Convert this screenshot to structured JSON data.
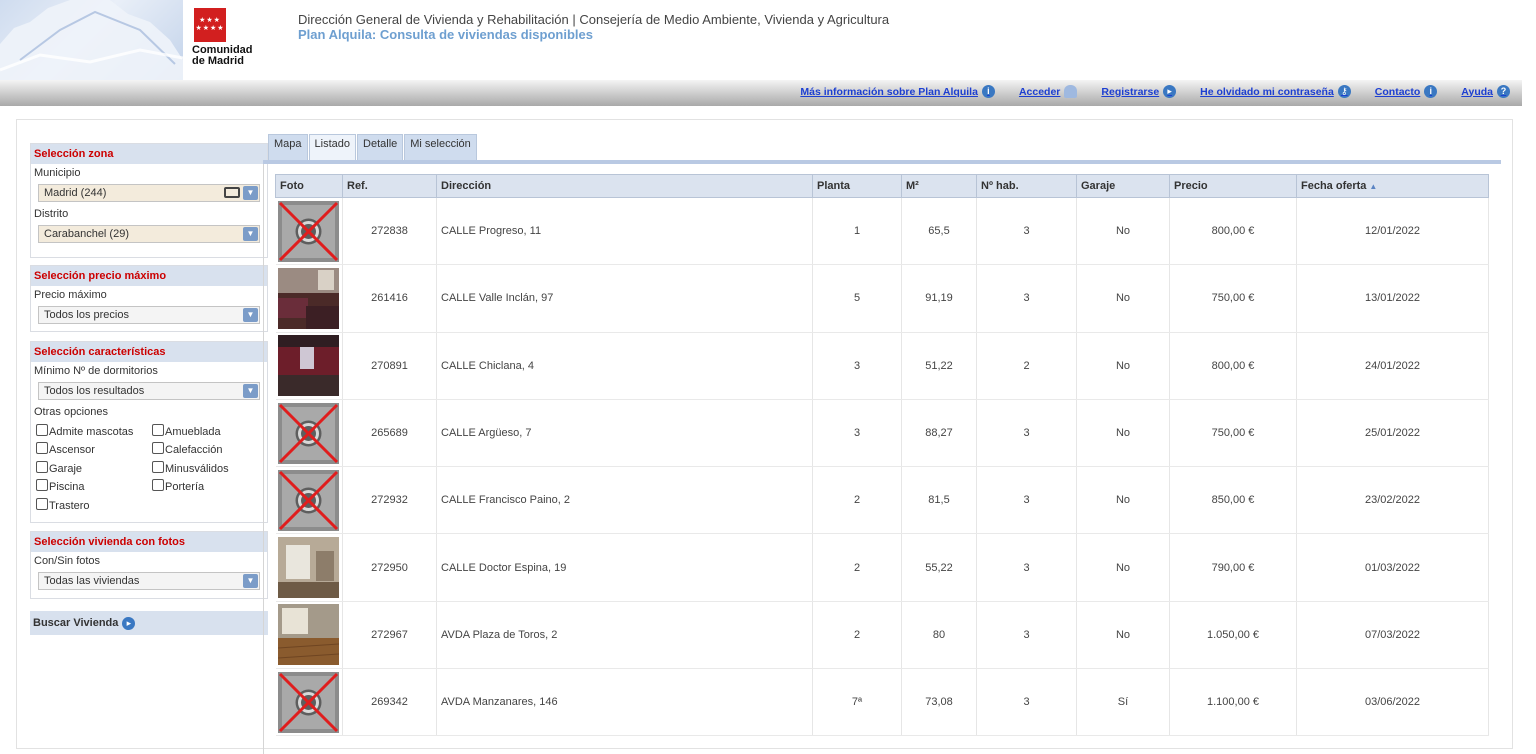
{
  "header": {
    "title": "Dirección General de Vivienda y Rehabilitación | Consejería de Medio Ambiente, Vivienda y Agricultura",
    "subtitle": "Plan Alquila: Consulta de viviendas disponibles",
    "logo_text": "Comunidad\nde Madrid",
    "logo_stars": "★★★\n★★★★",
    "logo_color": "#d21f1f"
  },
  "topnav": [
    {
      "label": "Más información sobre Plan Alquila",
      "icon": "info-icon"
    },
    {
      "label": "Acceder",
      "icon": "user-icon"
    },
    {
      "label": "Registrarse",
      "icon": "arrow-right-icon"
    },
    {
      "label": "He olvidado mi contraseña",
      "icon": "key-icon"
    },
    {
      "label": "Contacto",
      "icon": "info-icon"
    },
    {
      "label": "Ayuda",
      "icon": "help-icon"
    }
  ],
  "sidebar": {
    "zona": {
      "title": "Selección zona",
      "municipio_label": "Municipio",
      "municipio_value": "Madrid (244)",
      "distrito_label": "Distrito",
      "distrito_value": "Carabanchel (29)"
    },
    "precio": {
      "title": "Selección precio máximo",
      "label": "Precio máximo",
      "value": "Todos los precios"
    },
    "caracteristicas": {
      "title": "Selección características",
      "dorm_label": "Mínimo Nº de dormitorios",
      "dorm_value": "Todos los resultados",
      "otras_label": "Otras opciones",
      "options": [
        "Admite mascotas",
        "Amueblada",
        "Ascensor",
        "Calefacción",
        "Garaje",
        "Minusválidos",
        "Piscina",
        "Portería",
        "Trastero"
      ]
    },
    "fotos": {
      "title": "Selección vivienda con fotos",
      "label": "Con/Sin fotos",
      "value": "Todas las viviendas"
    },
    "buscar_label": "Buscar Vivienda"
  },
  "tabs": [
    "Mapa",
    "Listado",
    "Detalle",
    "Mi selección"
  ],
  "active_tab": "Listado",
  "table": {
    "columns": [
      "Foto",
      "Ref.",
      "Dirección",
      "Planta",
      "M²",
      "Nº hab.",
      "Garaje",
      "Precio",
      "Fecha oferta"
    ],
    "sort_column": "Fecha oferta",
    "sort_dir": "asc",
    "rows": [
      {
        "foto": "none",
        "ref": "272838",
        "direccion": "CALLE Progreso, 11",
        "planta": "1",
        "m2": "65,5",
        "hab": "3",
        "garaje": "No",
        "precio": "800,00 €",
        "fecha": "12/01/2022"
      },
      {
        "foto": "photo-living-room",
        "ref": "261416",
        "direccion": "CALLE Valle Inclán, 97",
        "planta": "5",
        "m2": "91,19",
        "hab": "3",
        "garaje": "No",
        "precio": "750,00 €",
        "fecha": "13/01/2022"
      },
      {
        "foto": "photo-red-room",
        "ref": "270891",
        "direccion": "CALLE Chiclana, 4",
        "planta": "3",
        "m2": "51,22",
        "hab": "2",
        "garaje": "No",
        "precio": "800,00 €",
        "fecha": "24/01/2022"
      },
      {
        "foto": "none",
        "ref": "265689",
        "direccion": "CALLE Argüeso, 7",
        "planta": "3",
        "m2": "88,27",
        "hab": "3",
        "garaje": "No",
        "precio": "750,00 €",
        "fecha": "25/01/2022"
      },
      {
        "foto": "none",
        "ref": "272932",
        "direccion": "CALLE Francisco Paino, 2",
        "planta": "2",
        "m2": "81,5",
        "hab": "3",
        "garaje": "No",
        "precio": "850,00 €",
        "fecha": "23/02/2022"
      },
      {
        "foto": "photo-empty-room",
        "ref": "272950",
        "direccion": "CALLE Doctor Espina, 19",
        "planta": "2",
        "m2": "55,22",
        "hab": "3",
        "garaje": "No",
        "precio": "790,00 €",
        "fecha": "01/03/2022"
      },
      {
        "foto": "photo-wood-floor",
        "ref": "272967",
        "direccion": "AVDA Plaza de Toros, 2",
        "planta": "2",
        "m2": "80",
        "hab": "3",
        "garaje": "No",
        "precio": "1.050,00 €",
        "fecha": "07/03/2022"
      },
      {
        "foto": "none",
        "ref": "269342",
        "direccion": "AVDA Manzanares, 146",
        "planta": "7ª",
        "m2": "73,08",
        "hab": "3",
        "garaje": "Sí",
        "precio": "1.100,00 €",
        "fecha": "03/06/2022"
      }
    ]
  },
  "colors": {
    "link": "#1d3fd1",
    "panel_title": "#cc0000",
    "subtitle": "#6e9fd0",
    "header_bg": "#d8e1ee"
  }
}
